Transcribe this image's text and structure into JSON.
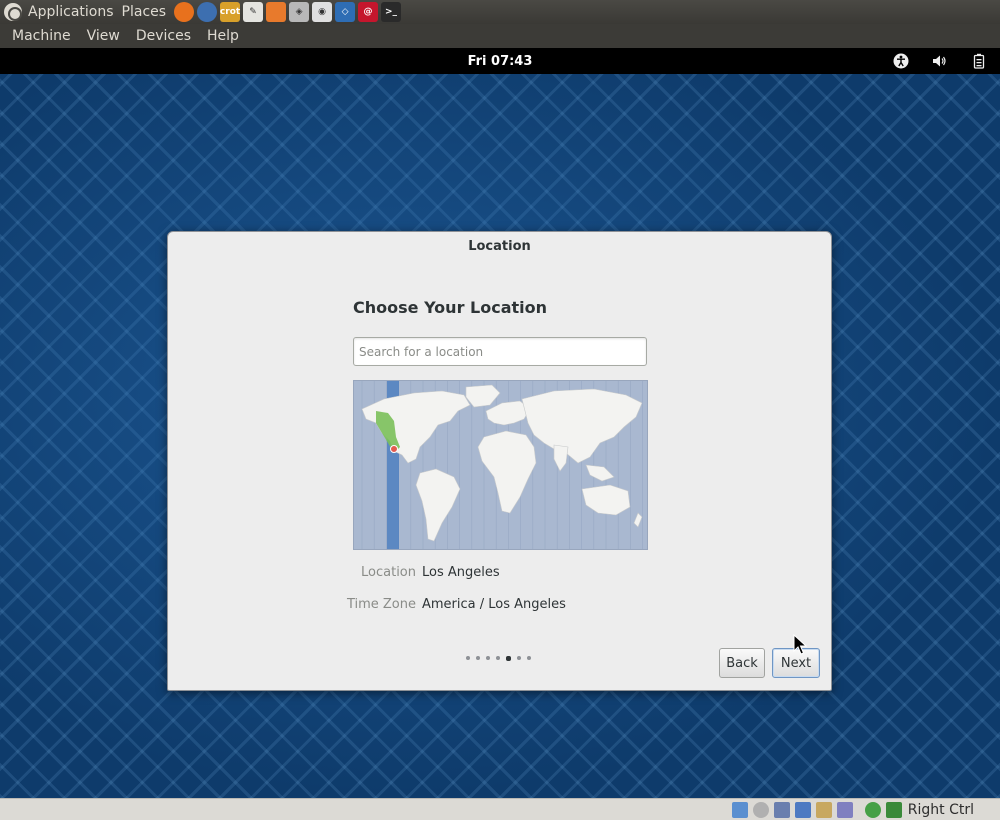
{
  "host_panel": {
    "menus": [
      "Applications",
      "Places"
    ],
    "launchers": [
      {
        "icon": "firefox-icon",
        "glyph": "",
        "color": "#e8711d"
      },
      {
        "icon": "thunderbird-icon",
        "glyph": "",
        "color": "#3d6fb0"
      },
      {
        "icon": "shutter-icon",
        "glyph": "crot",
        "color": "#d8a02a"
      },
      {
        "icon": "text-editor-icon",
        "glyph": "✎",
        "color": "#e4e4e0"
      },
      {
        "icon": "file-manager-icon",
        "glyph": "",
        "color": "#e87a2c"
      },
      {
        "icon": "image-viewer-icon",
        "glyph": "◈",
        "color": "#b8b8b8"
      },
      {
        "icon": "camera-icon",
        "glyph": "◉",
        "color": "#e0e0e0"
      },
      {
        "icon": "virtualbox-icon",
        "glyph": "◇",
        "color": "#2e6db4"
      },
      {
        "icon": "debian-icon",
        "glyph": "@",
        "color": "#c5162d"
      },
      {
        "icon": "terminal-icon",
        "glyph": ">_",
        "color": "#2a2a2a"
      }
    ]
  },
  "vbox_menu": [
    "Machine",
    "View",
    "Devices",
    "Help"
  ],
  "gnome_topbar": {
    "clock": "Fri 07:43",
    "status_icons": [
      "accessibility-icon",
      "volume-icon",
      "battery-icon"
    ]
  },
  "dialog": {
    "title": "Location",
    "heading": "Choose Your Location",
    "search_placeholder": "Search for a location",
    "location_label": "Location",
    "location_value": "Los Angeles",
    "timezone_label": "Time Zone",
    "timezone_value": "America / Los Angeles",
    "page_count": 7,
    "current_page": 5,
    "back_label": "Back",
    "next_label": "Next"
  },
  "statusbar": {
    "icons": [
      "hard-disk-icon",
      "optical-drive-icon",
      "usb-icon",
      "network-icon",
      "shared-folder-icon",
      "video-capture-icon",
      "virtualization-icon",
      "mouse-integration-icon"
    ],
    "host_key": "Right Ctrl"
  },
  "colors": {
    "desktop_blue": "#0e3b6b",
    "timezone_highlight": "#4f7fc0",
    "region_green": "#7bc05a",
    "pin_red": "#e35b4f"
  }
}
